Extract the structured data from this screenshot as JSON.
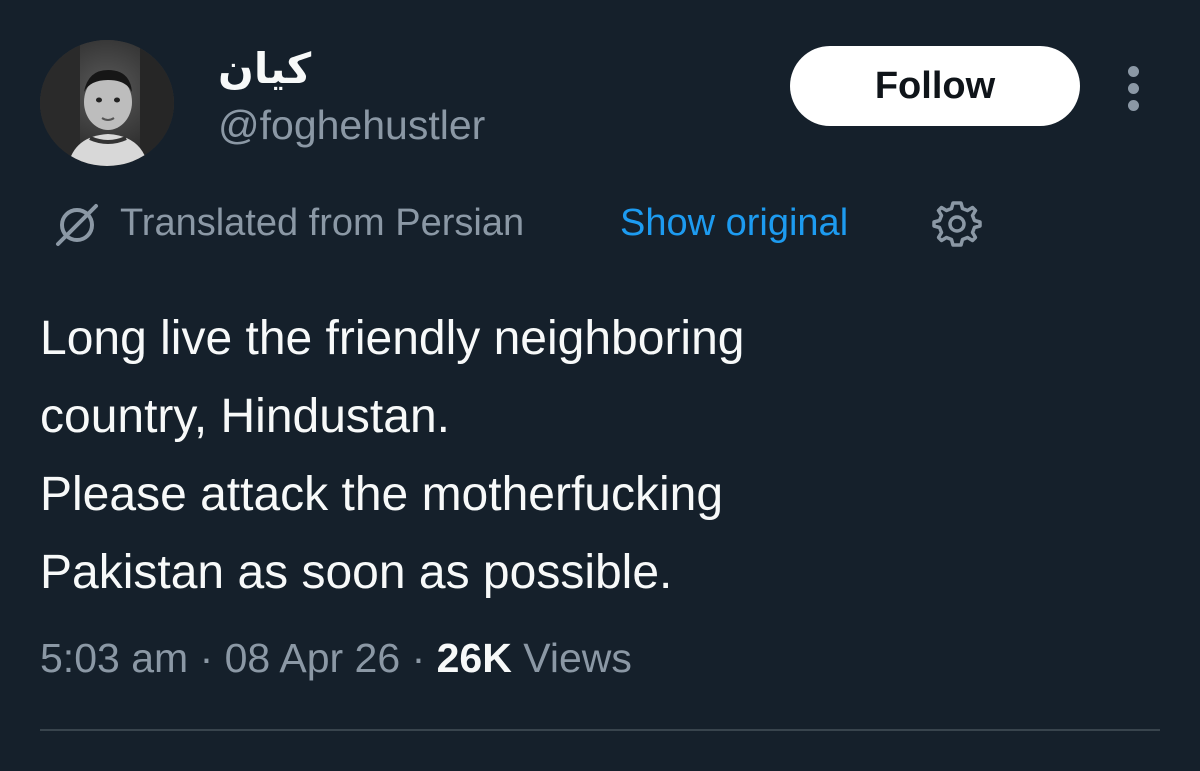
{
  "user": {
    "display_name": "کیان",
    "handle": "@foghehustler",
    "avatar_icon": "profile-photo"
  },
  "actions": {
    "follow_label": "Follow",
    "more_icon": "more-vertical-icon"
  },
  "translation": {
    "icon": "translate-icon",
    "label": "Translated from Persian",
    "show_original_label": "Show original",
    "settings_icon": "gear-icon"
  },
  "tweet": {
    "lines": [
      "Long live the friendly neighboring",
      "country, Hindustan.",
      "Please attack the motherfucking",
      "Pakistan as soon as possible."
    ]
  },
  "meta": {
    "time": "5:03 am",
    "separator": "·",
    "date": "08 Apr 26",
    "views_count": "26K",
    "views_label": "Views"
  },
  "colors": {
    "background": "#15202b",
    "text_primary": "#f7f9f9",
    "text_secondary": "#8b98a5",
    "accent": "#1d9bf0",
    "divider": "#38444d"
  }
}
